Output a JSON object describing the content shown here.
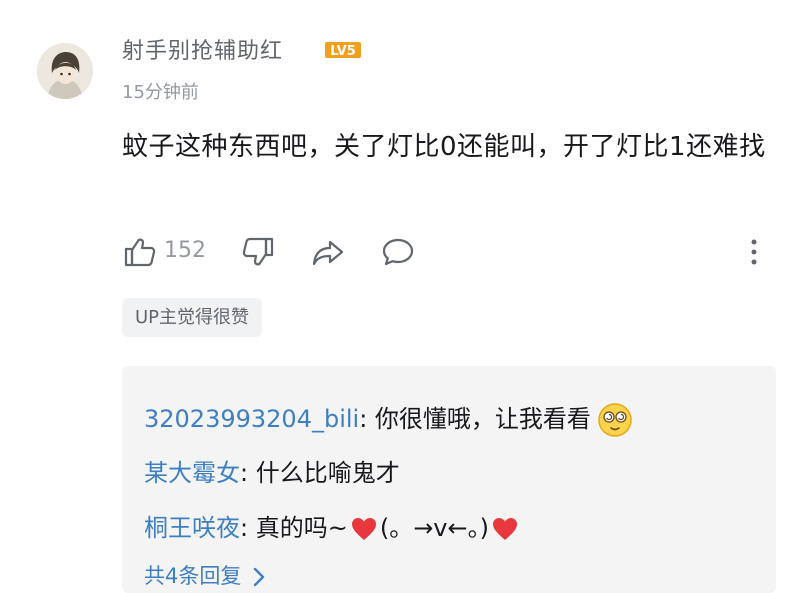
{
  "comment": {
    "username": "射手别抢辅助红",
    "level_badge": "LV5",
    "time": "15分钟前",
    "text": "蚊子这种东西吧，关了灯比0还能叫，开了灯比1还难找",
    "like_count": "152",
    "up_badge": "UP主觉得很赞"
  },
  "icons": {
    "like": "thumbs-up-icon",
    "dislike": "thumbs-down-icon",
    "share": "share-icon",
    "reply": "comment-bubble-icon",
    "more": "more-vertical-icon",
    "avatar": "user-avatar",
    "expand": "chevron-right-icon"
  },
  "replies": [
    {
      "user": "32023993204_bili",
      "separator": ": ",
      "text": "你很懂哦，让我看看",
      "emoji": "dizzy-face-emoji"
    },
    {
      "user": "某大霉女",
      "separator": ": ",
      "text": "什么比喻鬼才"
    },
    {
      "user": "桐王咲夜",
      "separator": ": ",
      "text_before": "真的吗~",
      "text_mid": "(。→v←。)",
      "emoji": "heart-emoji"
    }
  ],
  "reply_summary": "共4条回复",
  "colors": {
    "link_blue": "#3e7fc1",
    "level_orange": "#f0a01c",
    "heart_red": "#e8383d",
    "reply_bg": "#f4f4f5",
    "muted_gray": "#9499a0"
  }
}
